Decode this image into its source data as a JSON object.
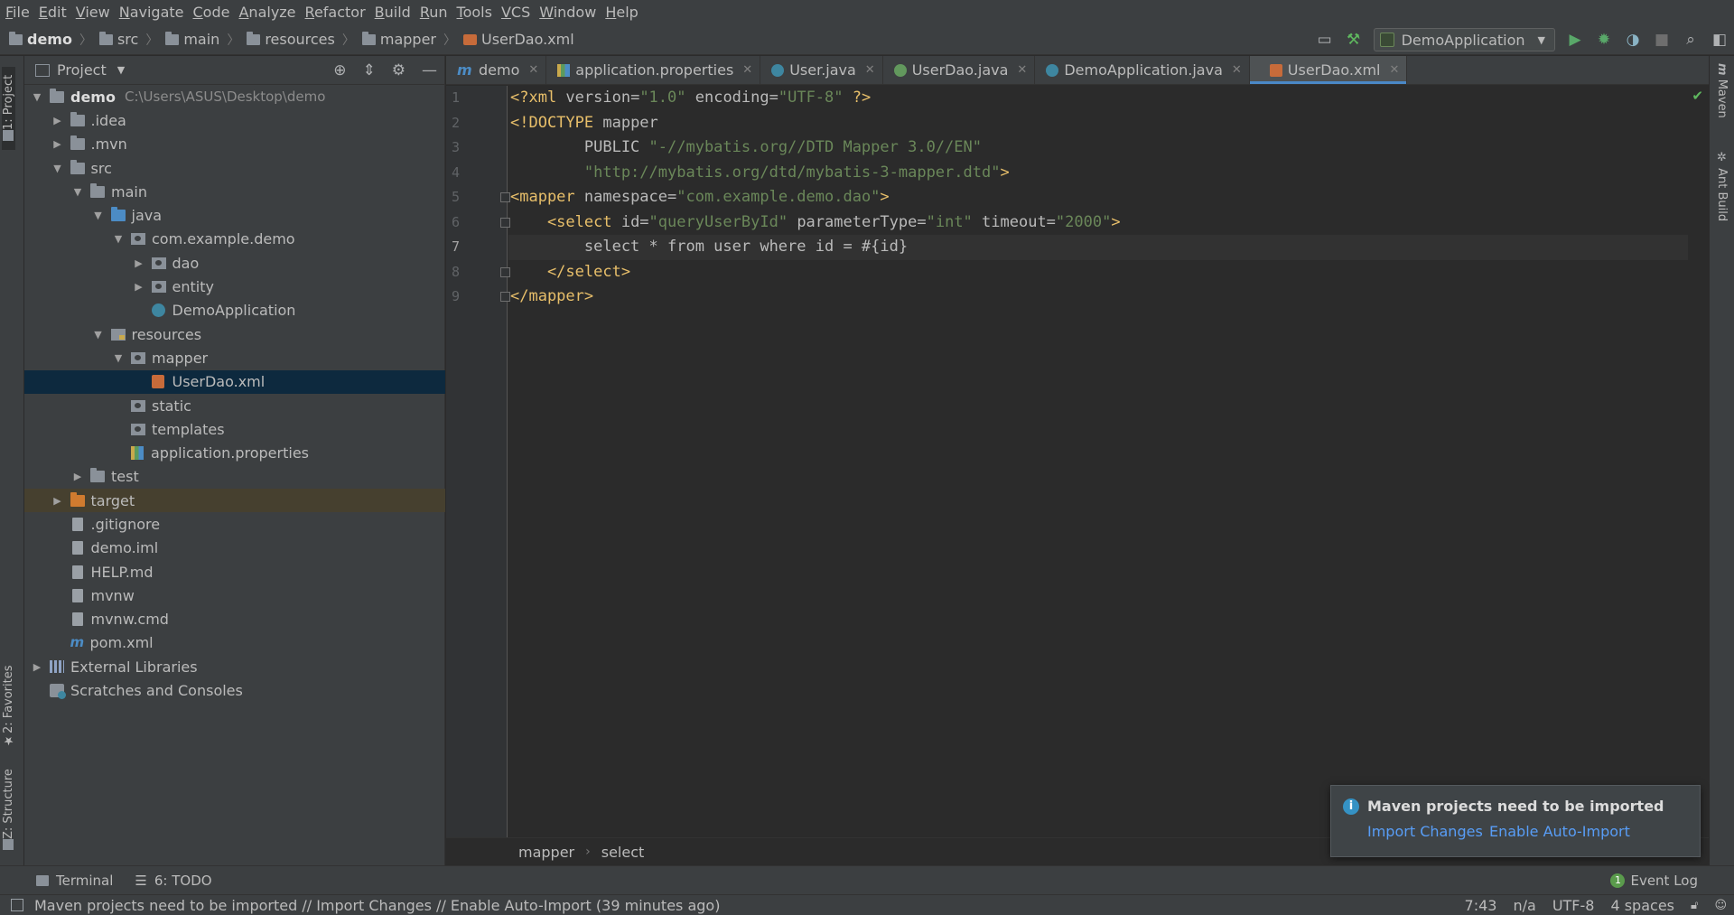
{
  "menu": [
    "File",
    "Edit",
    "View",
    "Navigate",
    "Code",
    "Analyze",
    "Refactor",
    "Build",
    "Run",
    "Tools",
    "VCS",
    "Window",
    "Help"
  ],
  "breadcrumbs": [
    "demo",
    "src",
    "main",
    "resources",
    "mapper",
    "UserDao.xml"
  ],
  "run_config": "DemoApplication",
  "left_tabs": {
    "project": "1: Project",
    "favorites": "2: Favorites",
    "structure": "Z: Structure"
  },
  "right_tabs": {
    "maven": "Maven",
    "ant": "Ant Build"
  },
  "project_panel": {
    "title": "Project",
    "tree": [
      {
        "label": "demo",
        "path": "C:\\Users\\ASUS\\Desktop\\demo",
        "level": 0,
        "arrow": "down",
        "icon": "module-folder-icon",
        "bold": true
      },
      {
        "label": ".idea",
        "level": 1,
        "arrow": "right",
        "icon": "folder-icon"
      },
      {
        "label": ".mvn",
        "level": 1,
        "arrow": "right",
        "icon": "folder-icon"
      },
      {
        "label": "src",
        "level": 1,
        "arrow": "down",
        "icon": "folder-icon"
      },
      {
        "label": "main",
        "level": 2,
        "arrow": "down",
        "icon": "folder-icon"
      },
      {
        "label": "java",
        "level": 3,
        "arrow": "down",
        "icon": "source-folder-icon"
      },
      {
        "label": "com.example.demo",
        "level": 4,
        "arrow": "down",
        "icon": "package-icon"
      },
      {
        "label": "dao",
        "level": 5,
        "arrow": "right",
        "icon": "package-icon"
      },
      {
        "label": "entity",
        "level": 5,
        "arrow": "right",
        "icon": "package-icon"
      },
      {
        "label": "DemoApplication",
        "level": 5,
        "arrow": "none",
        "icon": "spring-class-icon"
      },
      {
        "label": "resources",
        "level": 3,
        "arrow": "down",
        "icon": "resources-folder-icon"
      },
      {
        "label": "mapper",
        "level": 4,
        "arrow": "down",
        "icon": "package-icon"
      },
      {
        "label": "UserDao.xml",
        "level": 5,
        "arrow": "none",
        "icon": "xml-file-icon",
        "selected": true
      },
      {
        "label": "static",
        "level": 4,
        "arrow": "none",
        "icon": "package-icon"
      },
      {
        "label": "templates",
        "level": 4,
        "arrow": "none",
        "icon": "package-icon"
      },
      {
        "label": "application.properties",
        "level": 4,
        "arrow": "none",
        "icon": "properties-file-icon"
      },
      {
        "label": "test",
        "level": 2,
        "arrow": "right",
        "icon": "folder-icon"
      },
      {
        "label": "target",
        "level": 1,
        "arrow": "right",
        "icon": "excluded-folder-icon",
        "excluded": true
      },
      {
        "label": ".gitignore",
        "level": 1,
        "arrow": "none",
        "icon": "text-file-icon"
      },
      {
        "label": "demo.iml",
        "level": 1,
        "arrow": "none",
        "icon": "iml-file-icon"
      },
      {
        "label": "HELP.md",
        "level": 1,
        "arrow": "none",
        "icon": "text-file-icon"
      },
      {
        "label": "mvnw",
        "level": 1,
        "arrow": "none",
        "icon": "text-file-icon"
      },
      {
        "label": "mvnw.cmd",
        "level": 1,
        "arrow": "none",
        "icon": "text-file-icon"
      },
      {
        "label": "pom.xml",
        "level": 1,
        "arrow": "none",
        "icon": "maven-icon"
      },
      {
        "label": "External Libraries",
        "level": 0,
        "arrow": "right",
        "icon": "libraries-icon"
      },
      {
        "label": "Scratches and Consoles",
        "level": 0,
        "arrow": "none",
        "icon": "scratches-icon"
      }
    ]
  },
  "tabs": [
    {
      "label": "demo",
      "icon": "maven-icon"
    },
    {
      "label": "application.properties",
      "icon": "properties-file-icon"
    },
    {
      "label": "User.java",
      "icon": "class-icon"
    },
    {
      "label": "UserDao.java",
      "icon": "interface-icon"
    },
    {
      "label": "DemoApplication.java",
      "icon": "spring-class-icon"
    },
    {
      "label": "UserDao.xml",
      "icon": "xml-file-icon",
      "active": true
    }
  ],
  "editor": {
    "current_line": 7,
    "line_numbers": [
      "1",
      "2",
      "3",
      "4",
      "5",
      "6",
      "7",
      "8",
      "9"
    ],
    "lines": [
      [
        [
          "pi",
          "<?xml "
        ],
        [
          "at",
          "version="
        ],
        [
          "av",
          "\"1.0\""
        ],
        [
          "at",
          " encoding="
        ],
        [
          "av",
          "\"UTF-8\""
        ],
        [
          "pi",
          " ?>"
        ]
      ],
      [
        [
          "tg",
          "<!DOCTYPE "
        ],
        [
          "at",
          "mapper"
        ]
      ],
      [
        [
          "at",
          "        PUBLIC "
        ],
        [
          "av",
          "\"-//mybatis.org//DTD Mapper 3.0//EN\""
        ]
      ],
      [
        [
          "av",
          "        \"http://mybatis.org/dtd/mybatis-3-mapper.dtd\""
        ],
        [
          "tg",
          ">"
        ]
      ],
      [
        [
          "tg",
          "<mapper "
        ],
        [
          "at",
          "namespace="
        ],
        [
          "av",
          "\"com.example.demo.dao\""
        ],
        [
          "tg",
          ">"
        ]
      ],
      [
        [
          "tg",
          "    <select "
        ],
        [
          "at",
          "id="
        ],
        [
          "av",
          "\"queryUserById\""
        ],
        [
          "at",
          " parameterType="
        ],
        [
          "av",
          "\"int\""
        ],
        [
          "at",
          " timeout="
        ],
        [
          "av",
          "\"2000\""
        ],
        [
          "tg",
          ">"
        ]
      ],
      [
        [
          "at",
          "        select * from user where id = #{id}"
        ]
      ],
      [
        [
          "tg",
          "    </select>"
        ]
      ],
      [
        [
          "tg",
          "</mapper>"
        ]
      ]
    ],
    "breadcrumb": [
      "mapper",
      "select"
    ]
  },
  "notification": {
    "title": "Maven projects need to be imported",
    "link1": "Import Changes",
    "link2": "Enable Auto-Import"
  },
  "bottom_tools": {
    "terminal": "Terminal",
    "todo": "6: TODO",
    "event_log": "Event Log",
    "event_count": "1"
  },
  "status": {
    "message": "Maven projects need to be imported // Import Changes // Enable Auto-Import (39 minutes ago)",
    "position": "7:43",
    "na": "n/a",
    "encoding": "UTF-8",
    "indent": "4 spaces"
  }
}
